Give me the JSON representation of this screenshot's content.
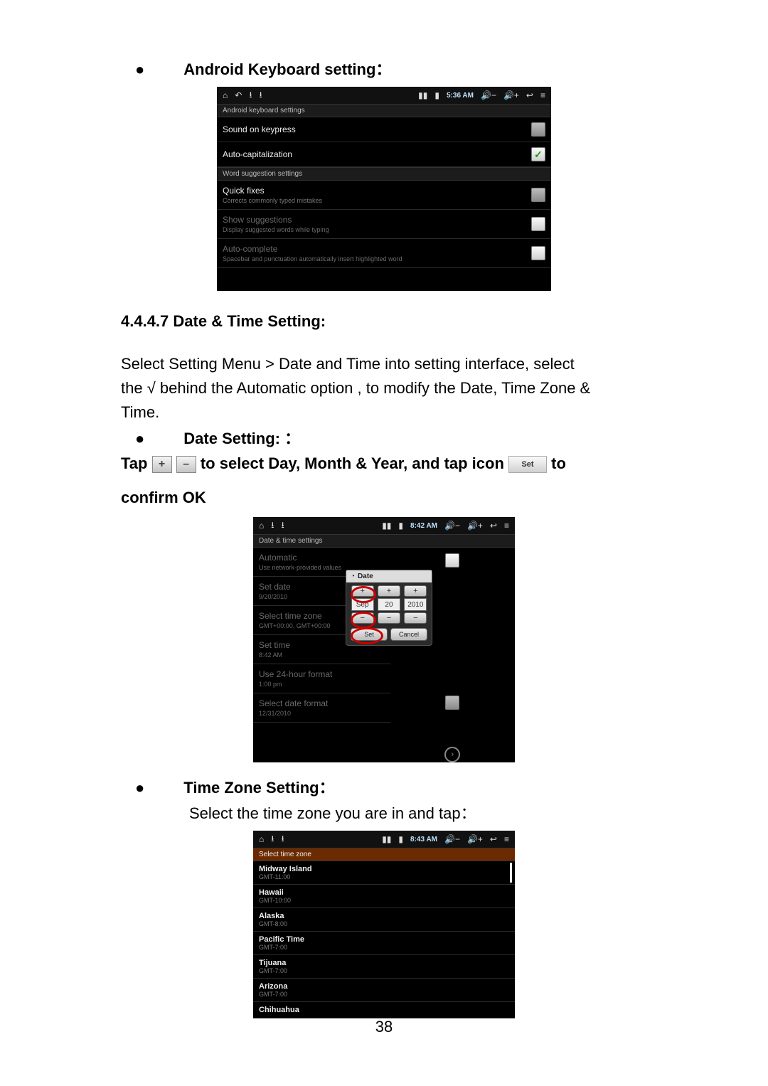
{
  "headings": {
    "keyboard": "Android Keyboard setting：",
    "datetime_num": "4.4.4.7 Date & Time Setting:",
    "date_setting": "Date Setting:  ：",
    "timezone": "Time Zone Setting："
  },
  "body": {
    "datetime_para1": "Select  Setting  Menu  >  Date  and  Time  into  setting  interface,  select",
    "datetime_para2": "the √ behind the Automatic option , to modify the Date, Time Zone &",
    "datetime_para3": "Time.",
    "tap_prefix": "Tap ",
    "tap_mid": " to select Day, Month & Year, and tap icon ",
    "tap_suffix": " to",
    "confirm": "confirm OK",
    "tz_select": "Select the time zone you are in and tap："
  },
  "mini": {
    "plus": "+",
    "minus": "–",
    "set": "Set"
  },
  "page_number": "38",
  "statusbar": {
    "time1": "5:36 AM",
    "time2": "8:42 AM",
    "time3": "8:43 AM",
    "vol_down": "−",
    "vol_up": "+"
  },
  "ss1": {
    "subheader1": "Android keyboard settings",
    "row1": "Sound on keypress",
    "row2": "Auto-capitalization",
    "subheader2": "Word suggestion settings",
    "row3_title": "Quick fixes",
    "row3_sub": "Corrects commonly typed mistakes",
    "row4_title": "Show suggestions",
    "row4_sub": "Display suggested words while typing",
    "row5_title": "Auto-complete",
    "row5_sub": "Spacebar and punctuation automatically insert highlighted word"
  },
  "ss2": {
    "subheader": "Date & time settings",
    "r1_title": "Automatic",
    "r1_sub": "Use network-provided values",
    "r2_title": "Set date",
    "r2_sub": "9/20/2010",
    "r3_title": "Select time zone",
    "r3_sub": "GMT+00:00, GMT+00:00",
    "r4_title": "Set time",
    "r4_sub": "8:42 AM",
    "r5_title": "Use 24-hour format",
    "r5_sub": "1:00 pm",
    "r6_title": "Select date format",
    "r6_sub": "12/31/2010",
    "dialog_title": "Date",
    "dialog_month": "Sep",
    "dialog_day": "20",
    "dialog_year": "2010",
    "dialog_set": "Set",
    "dialog_cancel": "Cancel"
  },
  "ss3": {
    "subheader": "Select time zone",
    "items": [
      {
        "name": "Midway Island",
        "offset": "GMT-11:00"
      },
      {
        "name": "Hawaii",
        "offset": "GMT-10:00"
      },
      {
        "name": "Alaska",
        "offset": "GMT-8:00"
      },
      {
        "name": "Pacific Time",
        "offset": "GMT-7:00"
      },
      {
        "name": "Tijuana",
        "offset": "GMT-7:00"
      },
      {
        "name": "Arizona",
        "offset": "GMT-7:00"
      },
      {
        "name": "Chihuahua",
        "offset": ""
      }
    ]
  }
}
